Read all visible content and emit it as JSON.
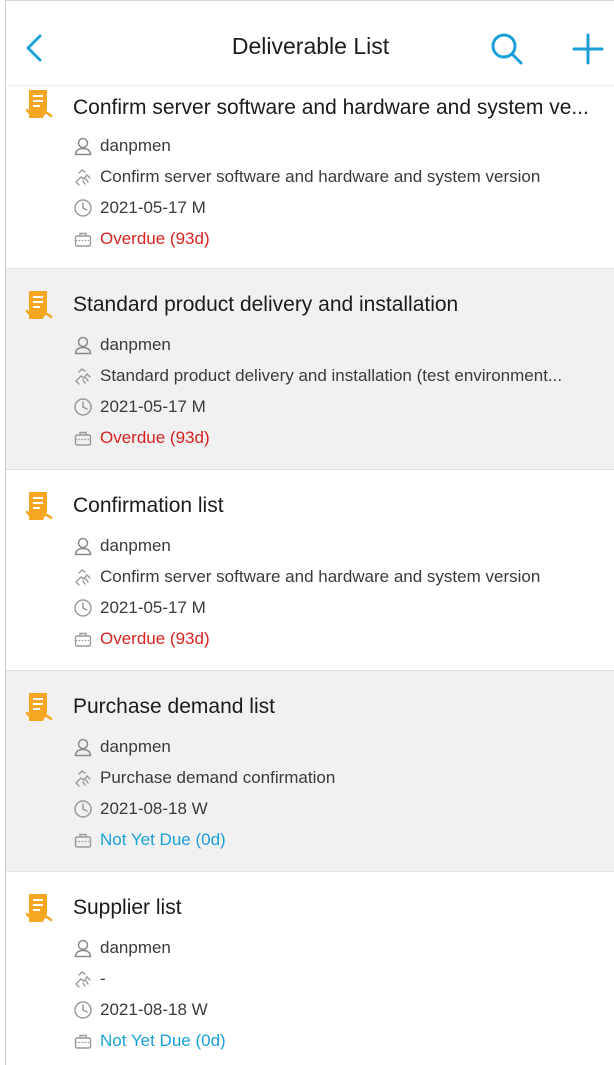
{
  "header": {
    "title": "Deliverable List",
    "back_icon": "chevron-left-icon",
    "search_icon": "search-icon",
    "add_icon": "plus-icon"
  },
  "colors": {
    "accent": "#1a9fd6",
    "doc_icon": "#f5a623",
    "overdue": "#d6231e",
    "not_due": "#1aa0d8"
  },
  "items": [
    {
      "title": "Confirm server software and hardware and system ve...",
      "owner": "danpmen",
      "description": "Confirm server software and hardware and system version",
      "date": "2021-05-17 M",
      "status": "Overdue (93d)"
    },
    {
      "title": "Standard product delivery and installation",
      "owner": "danpmen",
      "description": "Standard product delivery and installation (test environment...",
      "date": "2021-05-17 M",
      "status": "Overdue (93d)"
    },
    {
      "title": "Confirmation list",
      "owner": "danpmen",
      "description": "Confirm server software and hardware and system version",
      "date": "2021-05-17 M",
      "status": "Overdue (93d)"
    },
    {
      "title": "Purchase demand list",
      "owner": "danpmen",
      "description": "Purchase demand confirmation",
      "date": "2021-08-18 W",
      "status": "Not Yet Due (0d)"
    },
    {
      "title": "Supplier list",
      "owner": "danpmen",
      "description": "-",
      "date": "2021-08-18 W",
      "status": "Not Yet Due (0d)"
    }
  ]
}
